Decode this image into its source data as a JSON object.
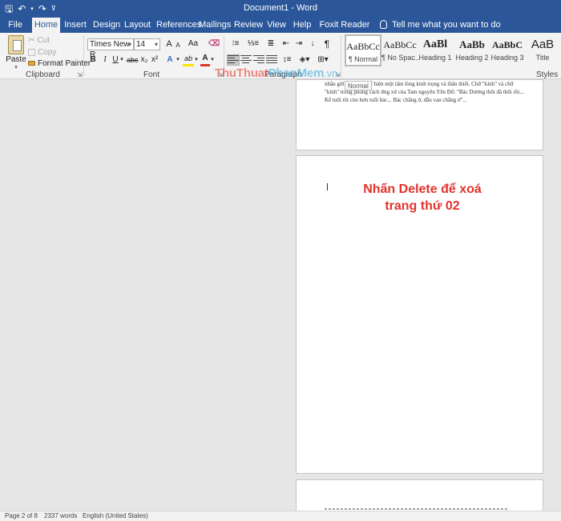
{
  "window": {
    "title": "Document1 - Word"
  },
  "quick_access": {
    "save_icon": "save-icon",
    "undo_icon": "undo-icon",
    "redo_icon": "redo-icon",
    "customize_icon": "customize-qat-icon"
  },
  "tabs": [
    {
      "label": "File"
    },
    {
      "label": "Home",
      "active": true
    },
    {
      "label": "Insert"
    },
    {
      "label": "Design"
    },
    {
      "label": "Layout"
    },
    {
      "label": "References"
    },
    {
      "label": "Mailings"
    },
    {
      "label": "Review"
    },
    {
      "label": "View"
    },
    {
      "label": "Help"
    },
    {
      "label": "Foxit Reader PDF"
    }
  ],
  "tell_me": {
    "text": "Tell me what you want to do"
  },
  "clipboard": {
    "paste_label": "Paste",
    "cut_label": "Cut",
    "copy_label": "Copy",
    "format_painter_label": "Format Painter",
    "group_label": "Clipboard"
  },
  "font": {
    "family": "Times New R",
    "size": "14",
    "change_case_label": "Aa",
    "bold_label": "B",
    "italic_label": "I",
    "underline_label": "U",
    "strike_label": "abc",
    "subscript_label": "x₂",
    "superscript_label": "x²",
    "text_effects_label": "A",
    "highlight_label": "ab",
    "font_color_label": "A",
    "grow_label": "A",
    "shrink_label": "A",
    "group_label": "Font",
    "highlight_color": "#ffe100",
    "font_color": "#e3322b"
  },
  "paragraph": {
    "group_label": "Paragraph",
    "show_marks_label": "¶"
  },
  "styles": {
    "group_label": "Styles",
    "items": [
      {
        "sample": "AaBbCc",
        "name": "¶ Normal",
        "selected": true
      },
      {
        "sample": "AaBbCc",
        "name": "¶ No Spac..."
      },
      {
        "sample": "AaBl",
        "name": "Heading 1"
      },
      {
        "sample": "AaBb",
        "name": "Heading 2"
      },
      {
        "sample": "AaBbC",
        "name": "Heading 3"
      },
      {
        "sample": "AaB",
        "name": "Title"
      }
    ]
  },
  "document": {
    "page1_text": "nhắn gửi... thước, thể hiện một tâm lòng kính trọng và thân thiết. Chữ \"kính\" và chữ \"kính\" trong phong cách ứng xử của Tam nguyên Yên Đổ: \"Bác Dương thôi đã thôi rồi... Kể tuổi tôi còn hơn tuổi bác... Bác chẳng ở, dẫu van chẳng ở\"...",
    "style_tooltip": "Normal",
    "annotation_line1": "Nhấn Delete để xoá",
    "annotation_line2": "trang thứ 02",
    "watermark": {
      "part1": "ThuThuat",
      "part2": "PhanMem",
      "part3": ".vn"
    }
  },
  "status": {
    "page": "Page 2 of 8",
    "words": "2337 words",
    "language": "English (United States)"
  }
}
